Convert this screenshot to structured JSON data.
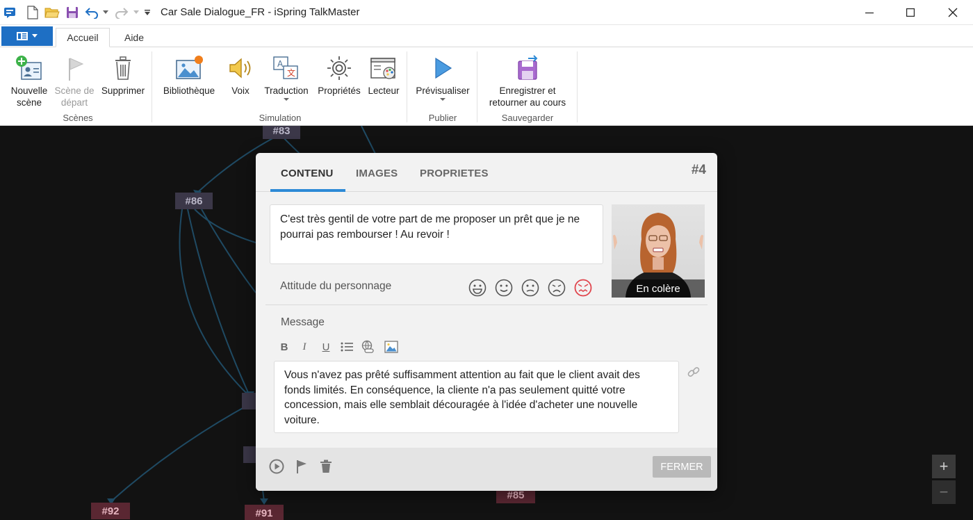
{
  "window": {
    "title": "Car Sale Dialogue_FR - iSpring TalkMaster"
  },
  "ribbon_tabs": [
    {
      "label": "Accueil",
      "active": true
    },
    {
      "label": "Aide",
      "active": false
    }
  ],
  "ribbon": {
    "scenes": {
      "new_scene": "Nouvelle scène",
      "start_scene": "Scène de départ",
      "delete": "Supprimer",
      "group": "Scènes"
    },
    "simulation": {
      "library": "Bibliothèque",
      "voice": "Voix",
      "translation": "Traduction",
      "properties": "Propriétés",
      "player": "Lecteur",
      "group": "Simulation"
    },
    "publish": {
      "preview": "Prévisualiser",
      "group": "Publier"
    },
    "save": {
      "save_return": "Enregistrer et retourner au cours",
      "group": "Sauvegarder"
    }
  },
  "canvas": {
    "nodes": [
      "#83",
      "#86",
      "#92",
      "#91",
      "#85"
    ],
    "zoom_in": "+",
    "zoom_out": "−"
  },
  "dialog": {
    "tabs": [
      "CONTENU",
      "IMAGES",
      "PROPRIETES"
    ],
    "active_tab": "CONTENU",
    "scene_number": "#4",
    "speech": "C'est très gentil de votre part de me proposer un prêt que je ne pourrai pas rembourser ! Au revoir !",
    "portrait_label": "En colère",
    "attitude_label": "Attitude du personnage",
    "selected_emotion": "angry",
    "message_label": "Message",
    "message": "Vous n'avez pas prêté suffisamment attention au fait que le client avait des fonds limités. En conséquence, la cliente n'a pas seulement quitté votre concession, mais elle semblait découragée à l'idée d'acheter une nouvelle voiture.",
    "close_label": "FERMER"
  },
  "colors": {
    "accent": "#1e6fc4",
    "tab_underline": "#2d8ad6",
    "angry": "#e0454d",
    "canvas_bg": "#121212"
  }
}
